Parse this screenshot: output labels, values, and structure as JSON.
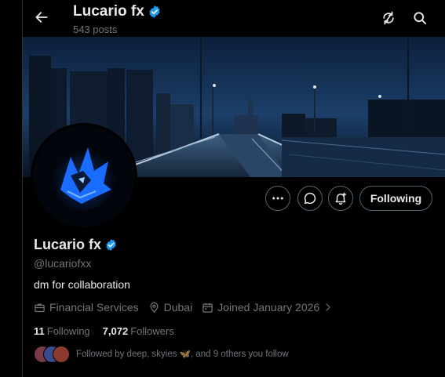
{
  "header": {
    "title": "Lucario fx",
    "post_count": "543 posts"
  },
  "profile": {
    "name": "Lucario fx",
    "handle": "@lucariofxx",
    "bio": "dm for collaboration",
    "category": "Financial Services",
    "location": "Dubai",
    "joined": "Joined January 2026",
    "following_count": "11",
    "following_label": "Following",
    "followers_count": "7,072",
    "followers_label": "Followers",
    "followed_by": "Followed by deep, skyies 🦋, and 9 others you follow"
  },
  "actions": {
    "follow_label": "Following"
  },
  "icons": {
    "back": "arrow-left-icon",
    "refresh": "refresh-icon",
    "search": "search-icon",
    "more": "more-icon",
    "message": "message-icon",
    "notify": "notification-bell-icon",
    "verified": "verified-badge-icon"
  },
  "colors": {
    "background": "#000000",
    "text_primary": "#e7e9ea",
    "text_secondary": "#71767b",
    "verified": "#1d9bf0",
    "border": "#536471"
  }
}
